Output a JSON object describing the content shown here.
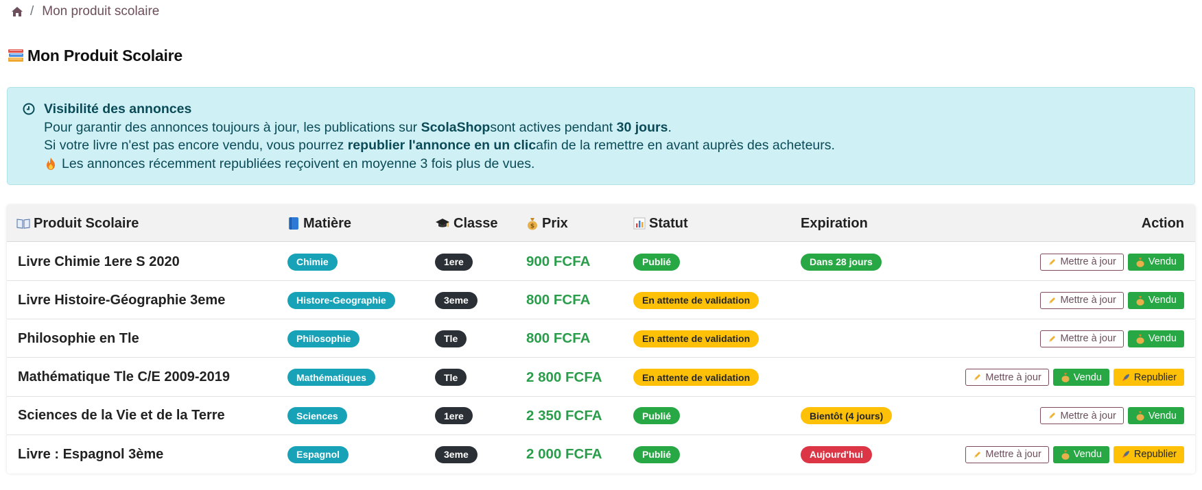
{
  "breadcrumb": {
    "separator": "/",
    "current": "Mon produit scolaire"
  },
  "page_title": "Mon Produit Scolaire",
  "alert": {
    "title": "Visibilité des annonces",
    "line1_a": "Pour garantir des annonces toujours à jour, les publications sur ",
    "line1_b": "ScolaShop",
    "line1_c": " sont actives pendant ",
    "line1_d": "30 jours",
    "line1_e": ".",
    "line2_a": "Si votre livre n'est pas encore vendu, vous pourrez ",
    "line2_b": "republier l'annonce en un clic",
    "line2_c": " afin de la remettre en avant auprès des acheteurs.",
    "line3": "Les annonces récemment republiées reçoivent en moyenne 3 fois plus de vues."
  },
  "table": {
    "headers": {
      "product": "Produit Scolaire",
      "subject": "Matière",
      "class": "Classe",
      "price": "Prix",
      "status": "Statut",
      "expiration": "Expiration",
      "action": "Action"
    },
    "rows": [
      {
        "name": "Livre Chimie 1ere S 2020",
        "subject": "Chimie",
        "class": "1ere",
        "price": "900 FCFA",
        "status": "Publié",
        "expiration": "Dans 28 jours",
        "update": "Mettre à jour",
        "sold": "Vendu",
        "republish": ""
      },
      {
        "name": "Livre Histoire-Géographie 3eme",
        "subject": "Histore-Geographie",
        "class": "3eme",
        "price": "800 FCFA",
        "status": "En attente de validation",
        "expiration": "",
        "update": "Mettre à jour",
        "sold": "Vendu",
        "republish": ""
      },
      {
        "name": "Philosophie en Tle",
        "subject": "Philosophie",
        "class": "Tle",
        "price": "800 FCFA",
        "status": "En attente de validation",
        "expiration": "",
        "update": "Mettre à jour",
        "sold": "Vendu",
        "republish": ""
      },
      {
        "name": "Mathématique Tle C/E 2009-2019",
        "subject": "Mathématiques",
        "class": "Tle",
        "price": "2 800 FCFA",
        "status": "En attente de validation",
        "expiration": "",
        "update": "Mettre à jour",
        "sold": "Vendu",
        "republish": "Republier"
      },
      {
        "name": "Sciences de la Vie et de la Terre",
        "subject": "Sciences",
        "class": "1ere",
        "price": "2 350 FCFA",
        "status": "Publié",
        "expiration": "Bientôt (4 jours)",
        "update": "Mettre à jour",
        "sold": "Vendu",
        "republish": ""
      },
      {
        "name": "Livre : Espagnol 3ème",
        "subject": "Espagnol",
        "class": "3eme",
        "price": "2 000 FCFA",
        "status": "Publié",
        "expiration": "Aujourd'hui",
        "update": "Mettre à jour",
        "sold": "Vendu",
        "republish": "Republier"
      }
    ]
  },
  "colors": {
    "published": "#28a745",
    "pending": "#ffc107",
    "expired_today": "#dc3545",
    "subject_pill": "#17a2b8",
    "class_pill": "#2b2f36",
    "price": "#2a9d4b",
    "alert_bg": "#cff0f5"
  },
  "icons": {
    "breadcrumb": "home-icon",
    "title": "books-icon",
    "alert": "clock-icon",
    "alert_line3": "fire-icon",
    "product": "open-book-icon",
    "subject": "blue-book-icon",
    "class": "graduation-cap-icon",
    "price": "money-bag-icon",
    "status": "bar-chart-icon",
    "update": "pencil-icon",
    "sold": "money-bag-icon",
    "republish": "rocket-icon"
  }
}
